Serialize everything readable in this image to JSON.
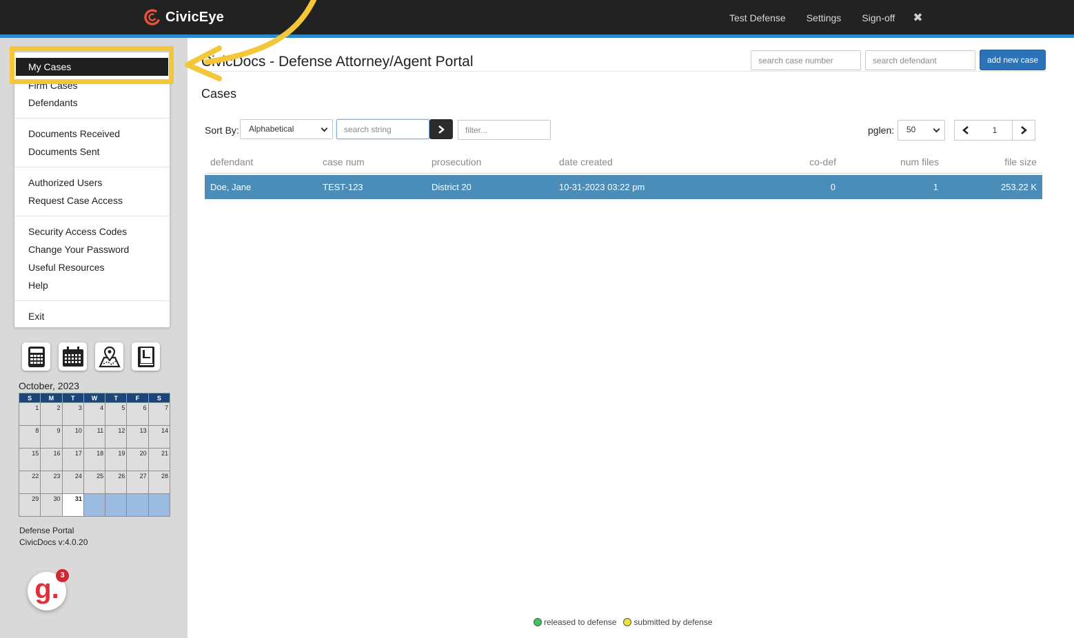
{
  "app": {
    "name": "CivicEye"
  },
  "topnav": {
    "user": "Test Defense",
    "settings": "Settings",
    "signoff": "Sign-off",
    "close": "✖"
  },
  "sidebar": {
    "active_item": "My Cases",
    "items": [
      "Firm Cases",
      "Defendants",
      "Documents Received",
      "Documents Sent",
      "Authorized Users",
      "Request Case Access",
      "Security Access Codes",
      "Change Your Password",
      "Useful Resources",
      "Help",
      "Exit"
    ],
    "tools": [
      "calculator-icon",
      "calendar-icon",
      "map-icon",
      "book-icon"
    ]
  },
  "calendar": {
    "title": "October, 2023",
    "weekdays": [
      "S",
      "M",
      "T",
      "W",
      "T",
      "F",
      "S"
    ],
    "weeks": [
      [
        "1",
        "2",
        "3",
        "4",
        "5",
        "6",
        "7"
      ],
      [
        "8",
        "9",
        "10",
        "11",
        "12",
        "13",
        "14"
      ],
      [
        "15",
        "16",
        "17",
        "18",
        "19",
        "20",
        "21"
      ],
      [
        "22",
        "23",
        "24",
        "25",
        "26",
        "27",
        "28"
      ],
      [
        "29",
        "30",
        "31",
        "",
        "",
        "",
        ""
      ]
    ],
    "today": "31"
  },
  "portal": {
    "name": "Defense Portal",
    "version": "CivicDocs v:4.0.20"
  },
  "badge": {
    "letter": "g.",
    "count": "3"
  },
  "header": {
    "title": "CivicDocs - Defense Attorney/Agent Portal",
    "search_case_placeholder": "search case number",
    "search_defendant_placeholder": "search defendant",
    "add_case": "add new case"
  },
  "cases": {
    "section_title": "Cases",
    "sort_label": "Sort By:",
    "sort_value": "Alphabetical",
    "search_placeholder": "search string",
    "filter_placeholder": "filter...",
    "pglen_label": "pglen:",
    "pglen_value": "50",
    "page": "1",
    "columns": [
      "defendant",
      "case num",
      "prosecution",
      "date created",
      "co-def",
      "num files",
      "file size"
    ],
    "rows": [
      [
        "Doe, Jane",
        "TEST-123",
        "District 20",
        "10-31-2023 03:22 pm",
        "0",
        "1",
        "253.22 K"
      ]
    ]
  },
  "legend": {
    "released": "released to defense",
    "submitted": "submitted by defense",
    "released_color": "#3ec45a",
    "submitted_color": "#f0e23a"
  },
  "colors": {
    "accent": "#2f88c8",
    "row_selected": "#4a8db8",
    "highlight": "#f4c73a",
    "brand": "#e8513a"
  }
}
